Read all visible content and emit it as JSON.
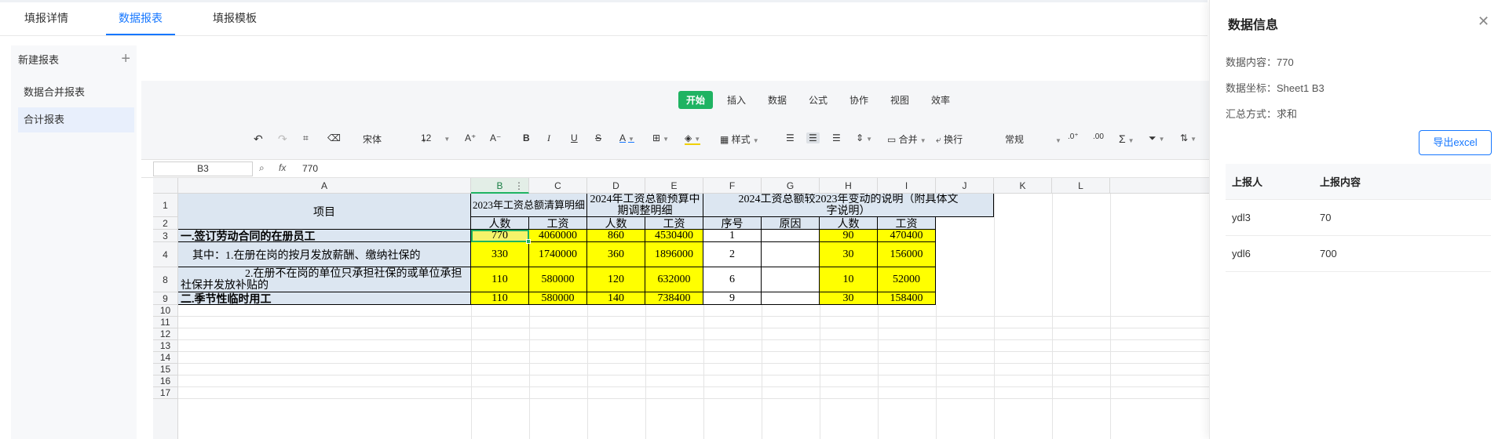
{
  "top_tabs": [
    {
      "label": "填报详情"
    },
    {
      "label": "数据报表"
    },
    {
      "label": "填报模板"
    }
  ],
  "sidebar": {
    "header": "新建报表",
    "items": [
      {
        "label": "数据合并报表"
      },
      {
        "label": "合计报表"
      }
    ]
  },
  "menu": [
    {
      "label": "开始"
    },
    {
      "label": "插入"
    },
    {
      "label": "数据"
    },
    {
      "label": "公式"
    },
    {
      "label": "协作"
    },
    {
      "label": "视图"
    },
    {
      "label": "效率"
    }
  ],
  "toolbar": {
    "font": "宋体",
    "font_size": "12",
    "style_label": "样式",
    "merge_label": "合并",
    "wrap_label": "换行",
    "number_format": "常规"
  },
  "formula_bar": {
    "cell_ref": "B3",
    "fx": "fx",
    "value": "770"
  },
  "columns": [
    "A",
    "B",
    "C",
    "D",
    "E",
    "F",
    "G",
    "H",
    "I",
    "J",
    "K",
    "L"
  ],
  "rows": [
    "1",
    "2",
    "3",
    "4",
    "8",
    "9",
    "10",
    "11",
    "12",
    "13",
    "14",
    "15",
    "16",
    "17"
  ],
  "sheet": {
    "a_header": "项目",
    "b_header_2023": "2023年工资总额清算明细",
    "d_header_2024": "2024年工资总额预算中期调整明细",
    "f_header_change": "2024工资总额较2023年变动的说明（附具体文字说明）",
    "sub_count": "人数",
    "sub_wage": "工资",
    "sub_seq": "序号",
    "sub_reason": "原因",
    "r3_label": "一.签订劳动合同的在册员工",
    "r4_label": "其中：1.在册在岗的按月发放薪酬、缴纳社保的",
    "r8_label": "2.在册不在岗的单位只承担社保的或单位承担社保并发放补贴的",
    "r9_label": "二.季节性临时用工",
    "r3": [
      "770",
      "4060000",
      "860",
      "4530400",
      "1",
      "",
      "90",
      "470400"
    ],
    "r4": [
      "330",
      "1740000",
      "360",
      "1896000",
      "2",
      "",
      "30",
      "156000"
    ],
    "r8": [
      "110",
      "580000",
      "120",
      "632000",
      "6",
      "",
      "10",
      "52000"
    ],
    "r9": [
      "110",
      "580000",
      "140",
      "738400",
      "9",
      "",
      "30",
      "158400"
    ]
  },
  "panel": {
    "title": "数据信息",
    "content_line": "数据内容：770",
    "coord_line": "数据坐标：Sheet1 B3",
    "method_line": "汇总方式：求和",
    "export_label": "导出excel",
    "table_headers": [
      "上报人",
      "上报内容"
    ],
    "table_rows": [
      [
        "ydl3",
        "70"
      ],
      [
        "ydl6",
        "700"
      ]
    ]
  },
  "colors": {
    "accent": "#1677ff",
    "sheet_green": "#1fb362",
    "header_blue": "#dce6f1",
    "highlight_yellow": "#ffff00"
  }
}
